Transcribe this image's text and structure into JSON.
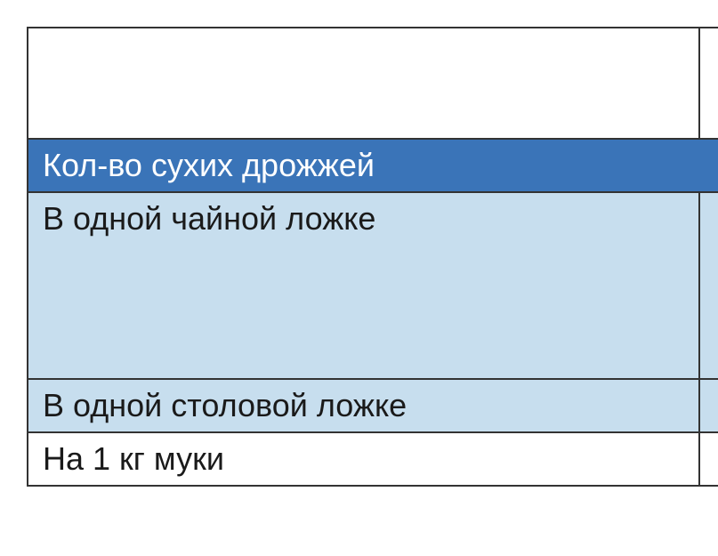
{
  "table": {
    "header": "Кол-во сухих дрожжей",
    "rows": [
      "В одной чайной ложке",
      "В одной столовой ложке",
      "На 1 кг муки"
    ]
  }
}
